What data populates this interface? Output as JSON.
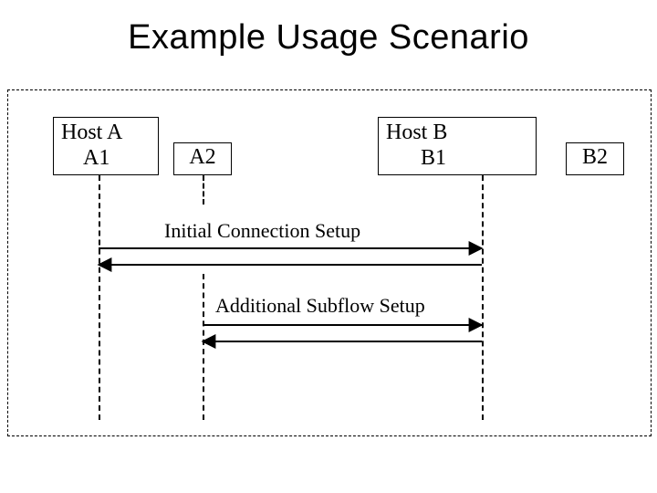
{
  "title": "Example Usage Scenario",
  "hosts": {
    "A": {
      "name": "Host A",
      "if1": "A1",
      "if2": "A2"
    },
    "B": {
      "name": "Host  B",
      "if1": "B1",
      "if2": "B2"
    }
  },
  "messages": {
    "initial": "Initial Connection Setup",
    "additional": "Additional Subflow Setup"
  }
}
